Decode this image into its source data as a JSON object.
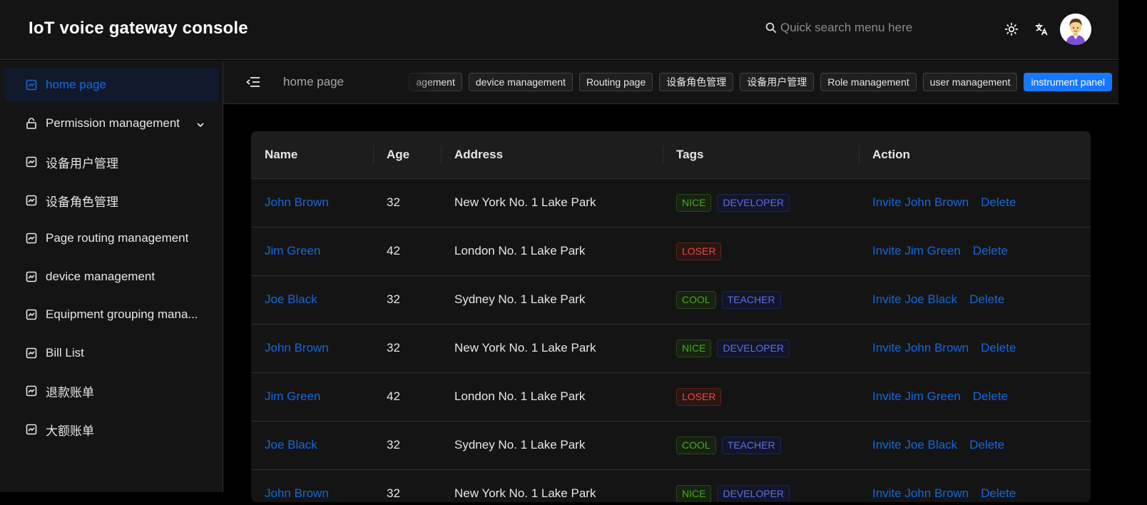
{
  "header": {
    "title": "IoT voice gateway console",
    "search_placeholder": "Quick search menu here",
    "icons": [
      "sun-icon",
      "translate-icon",
      "user-avatar"
    ]
  },
  "sidebar": {
    "items": [
      {
        "label": "home page",
        "icon": "chart-icon",
        "active": true
      },
      {
        "label": "Permission management",
        "icon": "lock-icon",
        "expandable": true
      },
      {
        "label": "设备用户管理",
        "icon": "chart-icon"
      },
      {
        "label": "设备角色管理",
        "icon": "chart-icon"
      },
      {
        "label": "Page routing management",
        "icon": "chart-icon"
      },
      {
        "label": "device management",
        "icon": "chart-icon"
      },
      {
        "label": "Equipment grouping mana...",
        "icon": "chart-icon"
      },
      {
        "label": "Bill List",
        "icon": "chart-icon"
      },
      {
        "label": "退款账单",
        "icon": "chart-icon"
      },
      {
        "label": "大额账单",
        "icon": "chart-icon"
      }
    ]
  },
  "tabbar": {
    "breadcrumb": "home page",
    "tabs": [
      {
        "label": "agement",
        "active": false
      },
      {
        "label": "device management",
        "active": false
      },
      {
        "label": "Routing page",
        "active": false
      },
      {
        "label": "设备角色管理",
        "active": false
      },
      {
        "label": "设备用户管理",
        "active": false
      },
      {
        "label": "Role management",
        "active": false
      },
      {
        "label": "user management",
        "active": false
      },
      {
        "label": "instrument panel",
        "active": true
      }
    ]
  },
  "table": {
    "columns": [
      "Name",
      "Age",
      "Address",
      "Tags",
      "Action"
    ],
    "delete_label": "Delete",
    "rows": [
      {
        "name": "John Brown",
        "age": "32",
        "address": "New York No. 1 Lake Park",
        "tags": [
          "NICE",
          "DEVELOPER"
        ],
        "invite": "Invite John Brown"
      },
      {
        "name": "Jim Green",
        "age": "42",
        "address": "London No. 1 Lake Park",
        "tags": [
          "LOSER"
        ],
        "invite": "Invite Jim Green"
      },
      {
        "name": "Joe Black",
        "age": "32",
        "address": "Sydney No. 1 Lake Park",
        "tags": [
          "COOL",
          "TEACHER"
        ],
        "invite": "Invite Joe Black"
      },
      {
        "name": "John Brown",
        "age": "32",
        "address": "New York No. 1 Lake Park",
        "tags": [
          "NICE",
          "DEVELOPER"
        ],
        "invite": "Invite John Brown"
      },
      {
        "name": "Jim Green",
        "age": "42",
        "address": "London No. 1 Lake Park",
        "tags": [
          "LOSER"
        ],
        "invite": "Invite Jim Green"
      },
      {
        "name": "Joe Black",
        "age": "32",
        "address": "Sydney No. 1 Lake Park",
        "tags": [
          "COOL",
          "TEACHER"
        ],
        "invite": "Invite Joe Black"
      },
      {
        "name": "John Brown",
        "age": "32",
        "address": "New York No. 1 Lake Park",
        "tags": [
          "NICE",
          "DEVELOPER"
        ],
        "invite": "Invite John Brown"
      }
    ]
  },
  "colors": {
    "accent": "#1677ff",
    "link": "#1668dc",
    "tag_green": "#49aa19",
    "tag_geekblue": "#5a6fe6",
    "tag_volcano": "#e84749"
  }
}
